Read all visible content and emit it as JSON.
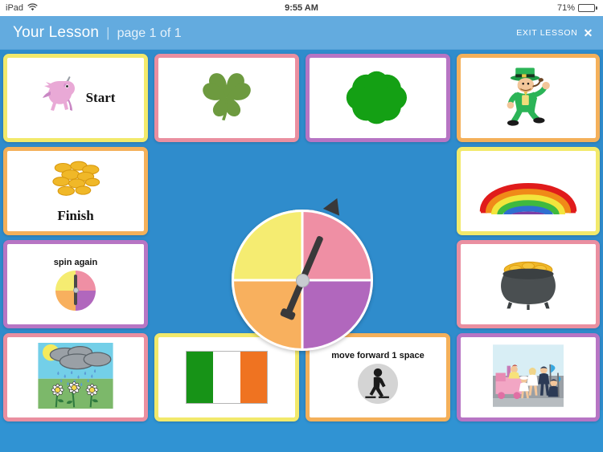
{
  "status_bar": {
    "device": "iPad",
    "wifi_icon": "wifi-icon",
    "time": "9:55 AM",
    "battery_percent": "71%",
    "battery_icon": "battery-icon"
  },
  "header": {
    "title": "Your Lesson",
    "separator": "|",
    "page_indicator": "page 1 of 1",
    "exit_label": "EXIT LESSON",
    "exit_icon": "close-x-icon",
    "background_color": "#63abdf"
  },
  "board": {
    "background_color": "#2f8ccc",
    "bottom_band_color": "#3093d3",
    "cards": [
      {
        "id": "start",
        "label": "Start",
        "icon": "unicorn-icon",
        "border_color": "#f2e96b",
        "label_style": "serif"
      },
      {
        "id": "shamrock",
        "label": "",
        "icon": "shamrock-icon",
        "border_color": "#ea8fa0",
        "label_style": "none"
      },
      {
        "id": "four-leaf",
        "label": "",
        "icon": "four-leaf-clover-icon",
        "border_color": "#b775c4",
        "label_style": "none"
      },
      {
        "id": "leprechaun",
        "label": "",
        "icon": "leprechaun-icon",
        "border_color": "#f4b05a",
        "label_style": "none"
      },
      {
        "id": "finish",
        "label": "Finish",
        "icon": "gold-coins-icon",
        "border_color": "#f4b05a",
        "label_style": "serif"
      },
      {
        "id": "rainbow",
        "label": "",
        "icon": "rainbow-icon",
        "border_color": "#f2e96b",
        "label_style": "none"
      },
      {
        "id": "spin-again",
        "label": "spin again",
        "icon": "spinner-icon",
        "border_color": "#b775c4",
        "label_style": "sans"
      },
      {
        "id": "pot-of-gold",
        "label": "",
        "icon": "pot-of-gold-icon",
        "border_color": "#ea8fa0",
        "label_style": "none"
      },
      {
        "id": "rain-flowers",
        "label": "",
        "icon": "rain-flowers-icon",
        "border_color": "#ea8fa0",
        "label_style": "none"
      },
      {
        "id": "irish-flag",
        "label": "",
        "icon": "irish-flag-icon",
        "border_color": "#f2e96b",
        "label_style": "none"
      },
      {
        "id": "move-forward",
        "label": "move forward 1 space",
        "icon": "walking-person-icon",
        "border_color": "#f4b05a",
        "label_style": "sans"
      },
      {
        "id": "parade",
        "label": "",
        "icon": "parade-scene-icon",
        "border_color": "#b775c4",
        "label_style": "none"
      }
    ]
  },
  "spinner": {
    "name": "four-color-spinner",
    "segments": [
      {
        "position": "top-left",
        "color": "#f5ec71"
      },
      {
        "position": "top-right",
        "color": "#ef8fa4"
      },
      {
        "position": "bottom-left",
        "color": "#f8b05e"
      },
      {
        "position": "bottom-right",
        "color": "#b167bd"
      }
    ],
    "needle_rotation_deg": 203,
    "needle_color": "#39393a",
    "hub_color": "#c8ccd0",
    "pointing_at": "bottom-left"
  },
  "mini_spinner": {
    "segments": [
      {
        "position": "top-left",
        "color": "#f5ec71"
      },
      {
        "position": "top-right",
        "color": "#ef8fa4"
      },
      {
        "position": "bottom-left",
        "color": "#f8b05e"
      },
      {
        "position": "bottom-right",
        "color": "#b167bd"
      }
    ],
    "needle_rotation_deg": 0
  }
}
